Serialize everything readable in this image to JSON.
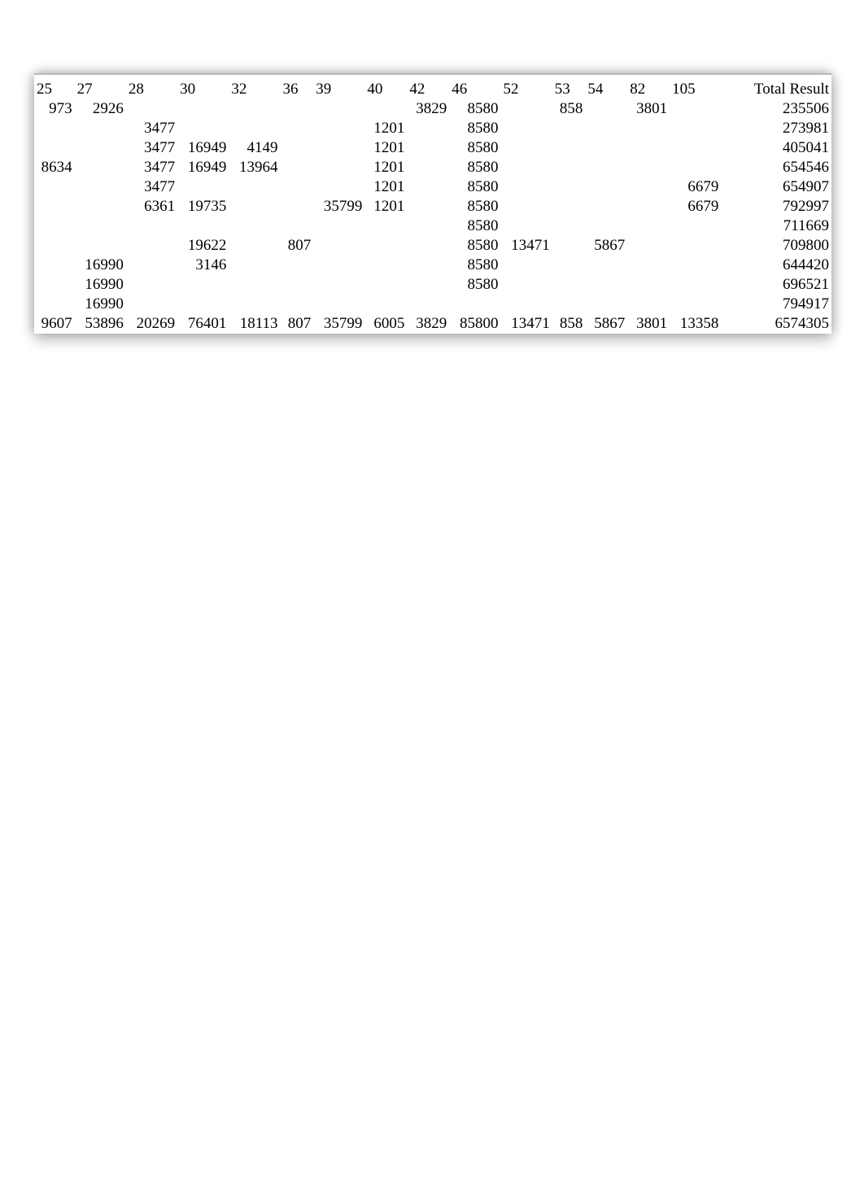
{
  "headers": {
    "c25": "25",
    "c27": "27",
    "c28": "28",
    "c30": "30",
    "c32": "32",
    "c36": "36",
    "c39": "39",
    "c40": "40",
    "c42": "42",
    "c46": "46",
    "c52": "52",
    "c53": "53",
    "c54": "54",
    "c82": "82",
    "c105": "105",
    "total": "Total Result"
  },
  "rows": [
    {
      "c25": "973",
      "c27": "2926",
      "c28": "",
      "c30": "",
      "c32": "",
      "c36": "",
      "c39": "",
      "c40": "",
      "c42": "3829",
      "c46": "8580",
      "c52": "",
      "c53": "858",
      "c54": "",
      "c82": "3801",
      "c105": "",
      "total": "235506"
    },
    {
      "c25": "",
      "c27": "",
      "c28": "3477",
      "c30": "",
      "c32": "",
      "c36": "",
      "c39": "",
      "c40": "1201",
      "c42": "",
      "c46": "8580",
      "c52": "",
      "c53": "",
      "c54": "",
      "c82": "",
      "c105": "",
      "total": "273981"
    },
    {
      "c25": "",
      "c27": "",
      "c28": "3477",
      "c30": "16949",
      "c32": "4149",
      "c36": "",
      "c39": "",
      "c40": "1201",
      "c42": "",
      "c46": "8580",
      "c52": "",
      "c53": "",
      "c54": "",
      "c82": "",
      "c105": "",
      "total": "405041"
    },
    {
      "c25": "8634",
      "c27": "",
      "c28": "3477",
      "c30": "16949",
      "c32": "13964",
      "c36": "",
      "c39": "",
      "c40": "1201",
      "c42": "",
      "c46": "8580",
      "c52": "",
      "c53": "",
      "c54": "",
      "c82": "",
      "c105": "",
      "total": "654546"
    },
    {
      "c25": "",
      "c27": "",
      "c28": "3477",
      "c30": "",
      "c32": "",
      "c36": "",
      "c39": "",
      "c40": "1201",
      "c42": "",
      "c46": "8580",
      "c52": "",
      "c53": "",
      "c54": "",
      "c82": "",
      "c105": "6679",
      "total": "654907"
    },
    {
      "c25": "",
      "c27": "",
      "c28": "6361",
      "c30": "19735",
      "c32": "",
      "c36": "",
      "c39": "35799",
      "c40": "1201",
      "c42": "",
      "c46": "8580",
      "c52": "",
      "c53": "",
      "c54": "",
      "c82": "",
      "c105": "6679",
      "total": "792997"
    },
    {
      "c25": "",
      "c27": "",
      "c28": "",
      "c30": "",
      "c32": "",
      "c36": "",
      "c39": "",
      "c40": "",
      "c42": "",
      "c46": "8580",
      "c52": "",
      "c53": "",
      "c54": "",
      "c82": "",
      "c105": "",
      "total": "711669"
    },
    {
      "c25": "",
      "c27": "",
      "c28": "",
      "c30": "19622",
      "c32": "",
      "c36": "807",
      "c39": "",
      "c40": "",
      "c42": "",
      "c46": "8580",
      "c52": "13471",
      "c53": "",
      "c54": "5867",
      "c82": "",
      "c105": "",
      "total": "709800"
    },
    {
      "c25": "",
      "c27": "16990",
      "c28": "",
      "c30": "3146",
      "c32": "",
      "c36": "",
      "c39": "",
      "c40": "",
      "c42": "",
      "c46": "8580",
      "c52": "",
      "c53": "",
      "c54": "",
      "c82": "",
      "c105": "",
      "total": "644420"
    },
    {
      "c25": "",
      "c27": "16990",
      "c28": "",
      "c30": "",
      "c32": "",
      "c36": "",
      "c39": "",
      "c40": "",
      "c42": "",
      "c46": "8580",
      "c52": "",
      "c53": "",
      "c54": "",
      "c82": "",
      "c105": "",
      "total": "696521"
    },
    {
      "c25": "",
      "c27": "16990",
      "c28": "",
      "c30": "",
      "c32": "",
      "c36": "",
      "c39": "",
      "c40": "",
      "c42": "",
      "c46": "",
      "c52": "",
      "c53": "",
      "c54": "",
      "c82": "",
      "c105": "",
      "total": "794917"
    }
  ],
  "totals": {
    "c25": "9607",
    "c27": "53896",
    "c28": "20269",
    "c30": "76401",
    "c32": "18113",
    "c36": "807",
    "c39": "35799",
    "c40": "6005",
    "c42": "3829",
    "c46": "85800",
    "c52": "13471",
    "c53": "858",
    "c54": "5867",
    "c82": "3801",
    "c105": "13358",
    "total": "6574305"
  }
}
